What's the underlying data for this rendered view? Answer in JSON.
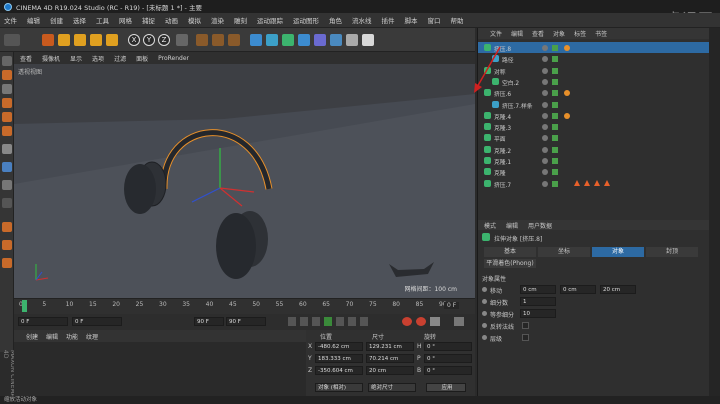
{
  "app": {
    "title": "CINEMA 4D R19.024 Studio (RC - R19) - [未标题 1 *] - 主要",
    "side_label": "MAXON CINEMA 4D"
  },
  "menu": [
    "文件",
    "编辑",
    "创建",
    "选择",
    "工具",
    "网格",
    "捕捉",
    "动画",
    "模拟",
    "渲染",
    "雕刻",
    "运动跟踪",
    "运动图形",
    "角色",
    "流水线",
    "插件",
    "脚本",
    "窗口",
    "帮助"
  ],
  "toolbar": {
    "axes": [
      "X",
      "Y",
      "Z"
    ]
  },
  "viewport": {
    "menu": [
      "查看",
      "摄像机",
      "显示",
      "选项",
      "过滤",
      "面板",
      "ProRender"
    ],
    "label": "透视视图",
    "grid_info": "网格间距：100 cm"
  },
  "timeline": {
    "ticks": [
      "0",
      "5",
      "10",
      "15",
      "20",
      "25",
      "30",
      "35",
      "40",
      "45",
      "50",
      "55",
      "60",
      "65",
      "70",
      "75",
      "80",
      "85",
      "90"
    ],
    "end_label": "0 F",
    "current_frame": "0 F",
    "start_frame": "0 F",
    "end_frame": "90 F",
    "end_frame2": "90 F"
  },
  "material": {
    "menu": [
      "创建",
      "编辑",
      "功能",
      "纹理"
    ]
  },
  "coordinates": {
    "headers": [
      "位置",
      "尺寸",
      "旋转"
    ],
    "rows": [
      {
        "axis": "X",
        "pos": "-480.62 cm",
        "size": "129.231 cm",
        "rot_label": "H",
        "rot": "0 °"
      },
      {
        "axis": "Y",
        "pos": "183.333 cm",
        "size": "70.214 cm",
        "rot_label": "P",
        "rot": "0 °"
      },
      {
        "axis": "Z",
        "pos": "-350.604 cm",
        "size": "20 cm",
        "rot_label": "B",
        "rot": "0 °"
      }
    ],
    "mode": "对象 (相对)",
    "size_mode": "绝对尺寸",
    "apply": "应用"
  },
  "objects": {
    "menu": [
      "文件",
      "编辑",
      "查看",
      "对象",
      "标签",
      "书签"
    ],
    "items": [
      {
        "name": "挤压.8",
        "indent": 0
      },
      {
        "name": "路径",
        "indent": 1
      },
      {
        "name": "对称",
        "indent": 0
      },
      {
        "name": "空白.2",
        "indent": 1
      },
      {
        "name": "挤压.6",
        "indent": 0
      },
      {
        "name": "挤压.7.样条",
        "indent": 1
      },
      {
        "name": "克隆.4",
        "indent": 0
      },
      {
        "name": "克隆.3",
        "indent": 0
      },
      {
        "name": "平面",
        "indent": 0
      },
      {
        "name": "克隆.2",
        "indent": 0
      },
      {
        "name": "克隆.1",
        "indent": 0
      },
      {
        "name": "克隆",
        "indent": 0
      },
      {
        "name": "挤压.7",
        "indent": 0
      }
    ]
  },
  "attributes": {
    "menu": [
      "模式",
      "编辑",
      "用户数据"
    ],
    "object_title": "拉伸对象 [挤压.8]",
    "tabs": [
      "基本",
      "坐标",
      "对象",
      "封顶"
    ],
    "active_tab": "对象",
    "phong": "平滑着色(Phong)",
    "section": "对象属性",
    "fields": [
      {
        "label": "移动",
        "values": [
          "0 cm",
          "0 cm",
          "20 cm"
        ]
      },
      {
        "label": "细分数",
        "values": [
          "1"
        ]
      },
      {
        "label": "等参细分",
        "values": [
          "10"
        ]
      },
      {
        "label": "反转法线",
        "values": [
          ""
        ]
      },
      {
        "label": "层级",
        "values": [
          ""
        ]
      }
    ]
  },
  "status": {
    "text": "缩放活动对象"
  },
  "watermark": "虎课网",
  "colors": {
    "accent": "#e8902a",
    "selection": "#2d6aa3",
    "viewport_bg": "#3d3f44"
  }
}
